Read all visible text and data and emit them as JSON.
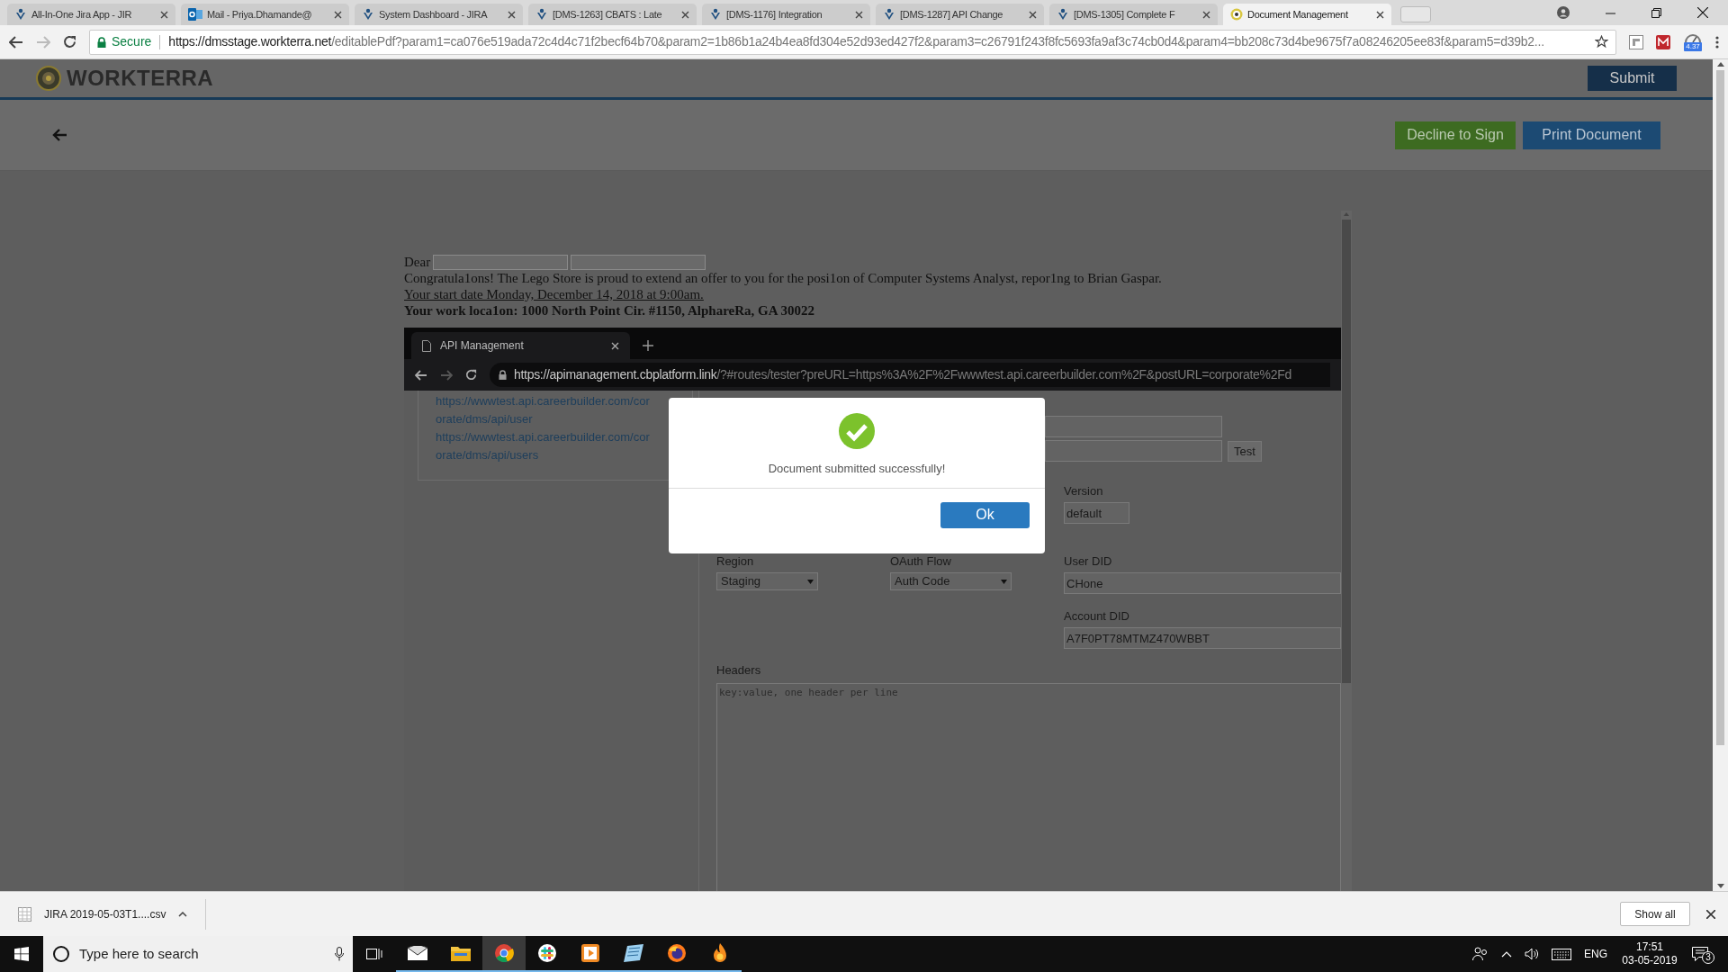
{
  "browser": {
    "tabs": [
      {
        "title": "All-In-One Jira App - JIR",
        "kind": "jira",
        "selected": false
      },
      {
        "title": "Mail - Priya.Dhamande@",
        "kind": "outlook",
        "selected": false
      },
      {
        "title": "System Dashboard - JIRA",
        "kind": "jira",
        "selected": false
      },
      {
        "title": "[DMS-1263] CBATS : Late",
        "kind": "jira",
        "selected": false
      },
      {
        "title": "[DMS-1176] Integration",
        "kind": "jira",
        "selected": false
      },
      {
        "title": "[DMS-1287] API Change",
        "kind": "jira",
        "selected": false
      },
      {
        "title": "[DMS-1305] Complete F",
        "kind": "jira",
        "selected": false
      },
      {
        "title": "Document Management",
        "kind": "workterra",
        "selected": true
      }
    ],
    "secure_label": "Secure",
    "url_host": "https://dmsstage.workterra.net",
    "url_rest": "/editablePdf?param1=ca076e519ada72c4d4c71f2becf64b70&param2=1b86b1a24b4ea8fd304e52d93ed427f2&param3=c26791f243f8fc5693fa9af3c74cb0d4&param4=bb208c73d4be9675f7a08246205ee83f&param5=d39b2...",
    "extension_badge": "4.37"
  },
  "app": {
    "logo": "WORKTERRA",
    "submit": "Submit",
    "decline": "Decline to Sign",
    "print": "Print Document"
  },
  "letter": {
    "greeting": "Dear",
    "body": "Congratula1ons! The Lego Store is proud to extend an offer to you for the posi1on of Computer Systems Analyst, repor1ng to Brian Gaspar.",
    "start_date": "Your start date Monday, December 14, 2018 at 9:00am.",
    "location": "Your work loca1on: 1000 North Point Cir. #1150, AlphareRa, GA 30022"
  },
  "embedded": {
    "tab_title": "API Management",
    "url_host": "https://apimanagement.cbplatform.link",
    "url_rest": "/?#routes/tester?preURL=https%3A%2F%2Fwwwtest.api.careerbuilder.com%2F&postURL=corporate%2Fd",
    "endpoints": [
      "https://wwwtest.api.careerbuilder.com/cor",
      "orate/dms/api/user",
      "https://wwwtest.api.careerbuilder.com/cor",
      "orate/dms/api/users"
    ],
    "test_button": "Test",
    "version": {
      "label": "Version",
      "value": "default"
    },
    "region": {
      "label": "Region",
      "value": "Staging"
    },
    "oauth": {
      "label": "OAuth Flow",
      "value": "Auth Code"
    },
    "user_did": {
      "label": "User DID",
      "value": "CHone"
    },
    "account_did": {
      "label": "Account DID",
      "value": "A7F0PT78MTMZ470WBBT"
    },
    "headers": {
      "label": "Headers",
      "placeholder": "key:value, one header per line"
    }
  },
  "dialog": {
    "message": "Document submitted successfully!",
    "ok": "Ok"
  },
  "download_bar": {
    "file": "JIRA 2019-05-03T1....csv",
    "show_all": "Show all"
  },
  "taskbar": {
    "search_placeholder": "Type here to search",
    "apps": [
      {
        "kind": "mail",
        "selected": false
      },
      {
        "kind": "explorer",
        "selected": false
      },
      {
        "kind": "chrome",
        "selected": true
      },
      {
        "kind": "slack",
        "selected": false
      },
      {
        "kind": "media",
        "selected": false
      },
      {
        "kind": "notes",
        "selected": false
      },
      {
        "kind": "firefox",
        "selected": false
      },
      {
        "kind": "flame",
        "selected": false
      }
    ],
    "language": "ENG",
    "time": "17:51",
    "date": "03-05-2019",
    "notifications": "3"
  }
}
